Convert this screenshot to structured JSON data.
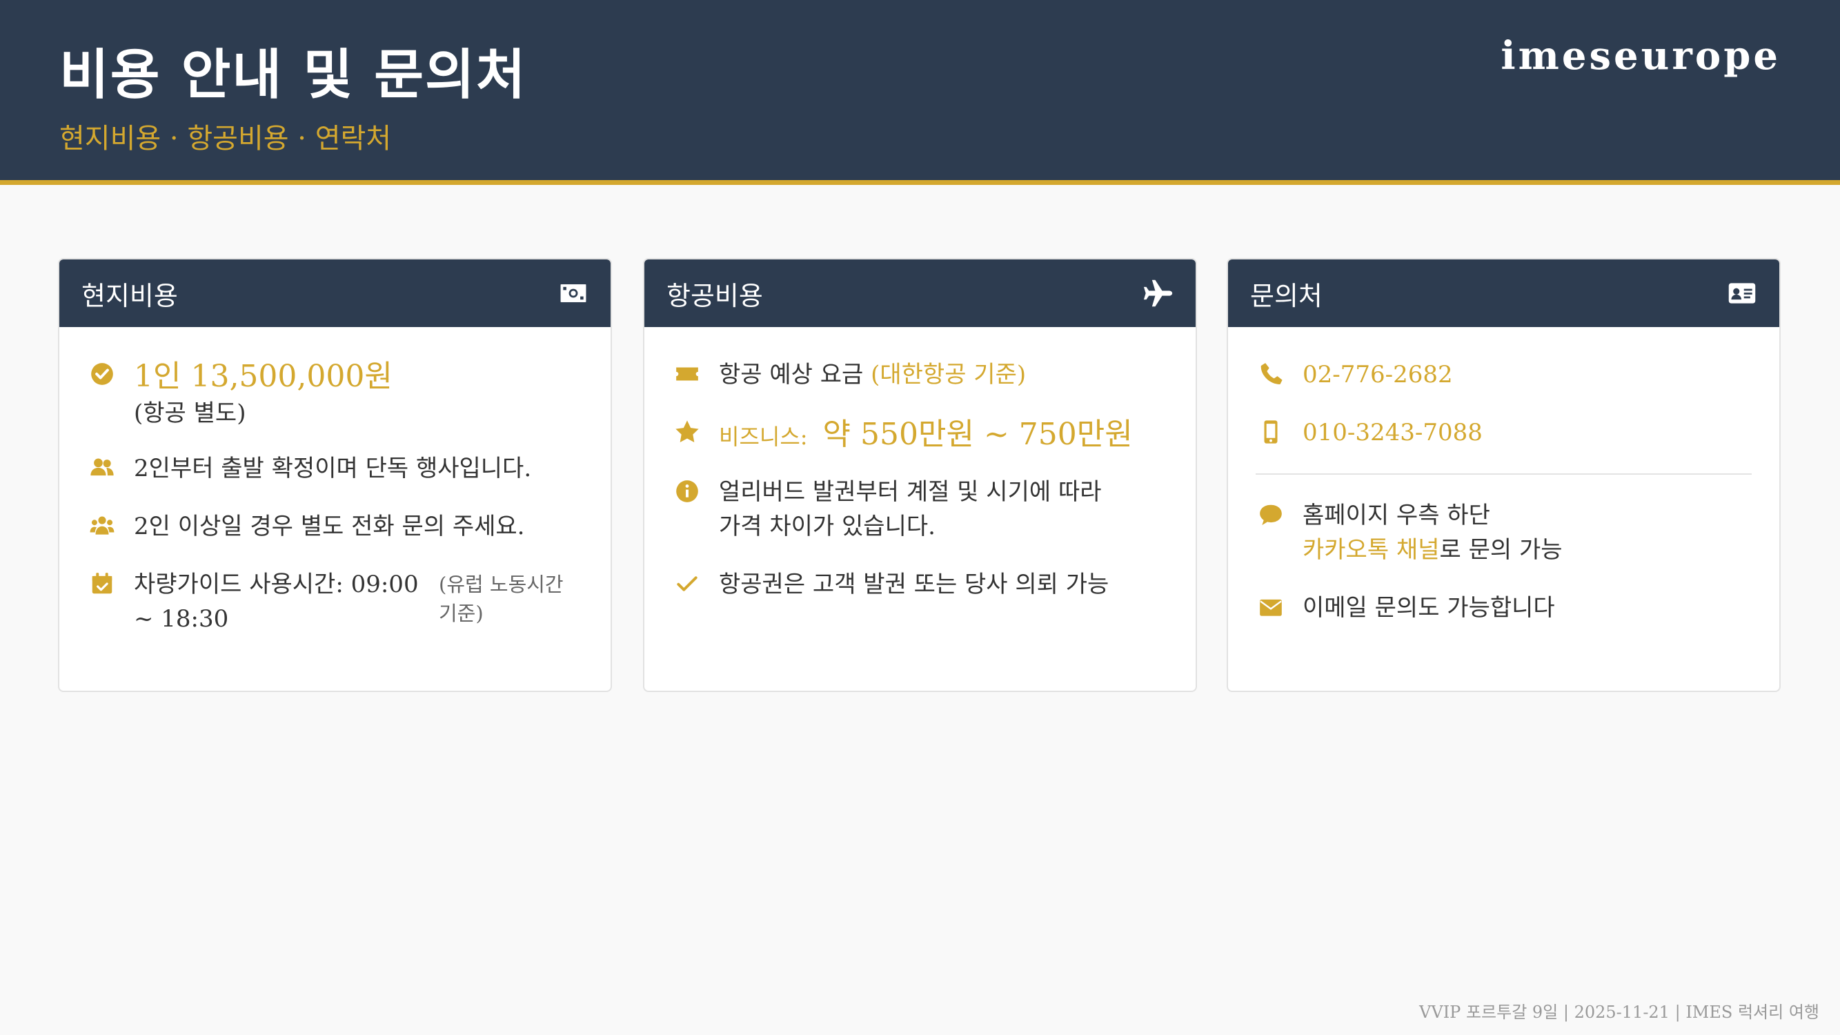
{
  "header": {
    "title": "비용 안내 및 문의처",
    "subtitle": "현지비용 · 항공비용 · 연락처",
    "brand": "imeseurope"
  },
  "colors": {
    "navy": "#2d3c50",
    "gold": "#d4a82f",
    "background": "#f9f9f9"
  },
  "cards": {
    "local": {
      "title": "현지비용",
      "icon": "money-bill-icon",
      "price": "1인 13,500,000원",
      "price_note": "(항공 별도)",
      "item_1": "2인부터 출발 확정이며 단독 행사입니다.",
      "item_2": "2인 이상일 경우 별도 전화 문의 주세요.",
      "item_3_main": "차량가이드 사용시간: 09:00 ~ 18:30",
      "item_3_note": "(유럽 노동시간 기준)"
    },
    "flight": {
      "title": "항공비용",
      "icon": "plane-icon",
      "fare_label": "항공 예상 요금",
      "fare_basis": "(대한항공 기준)",
      "business_label": "비즈니스:",
      "business_price": "약 550만원 ~ 750만원",
      "note_line_1": "얼리버드 발권부터 계절 및 시기에 따라",
      "note_line_2": "가격 차이가 있습니다.",
      "ticket_note": "항공권은 고객 발권 또는 당사 의뢰 가능"
    },
    "contact": {
      "title": "문의처",
      "icon": "id-card-icon",
      "phone": "02-776-2682",
      "mobile": "010-3243-7088",
      "kakao_line_1": "홈페이지 우측 하단",
      "kakao_channel": "카카오톡 채널",
      "kakao_suffix": "로 문의 가능",
      "email_note": "이메일 문의도 가능합니다"
    }
  },
  "footer": "VVIP 포르투갈 9일 | 2025-11-21 | IMES 럭셔리 여행"
}
